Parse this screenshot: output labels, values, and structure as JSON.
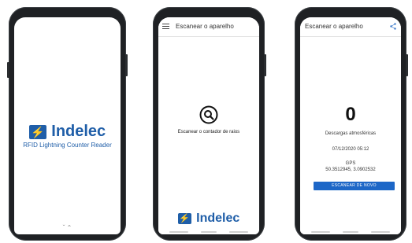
{
  "brand": {
    "name": "Indelec",
    "tagline": "RFID Lightning Counter Reader",
    "color": "#1f5ea8"
  },
  "splash": {
    "bottom_glyph": "ˇ ⌃"
  },
  "scan_screen": {
    "title": "Escanear o aparelho",
    "menu_icon": "menu-icon",
    "search_icon": "search-icon",
    "instruction": "Escanear o contador de raios"
  },
  "result_screen": {
    "title": "Escanear o aparelho",
    "share_icon": "share-icon",
    "counter_value": "0",
    "counter_label": "Descargas atmosféricas",
    "datetime": "07/12/2020 05:12",
    "gps_label": "GPS",
    "gps_coordinates": "50.3512945, 3.0902532",
    "scan_again_label": "ESCANEAR DE NOVO",
    "button_color": "#1d67c7"
  }
}
